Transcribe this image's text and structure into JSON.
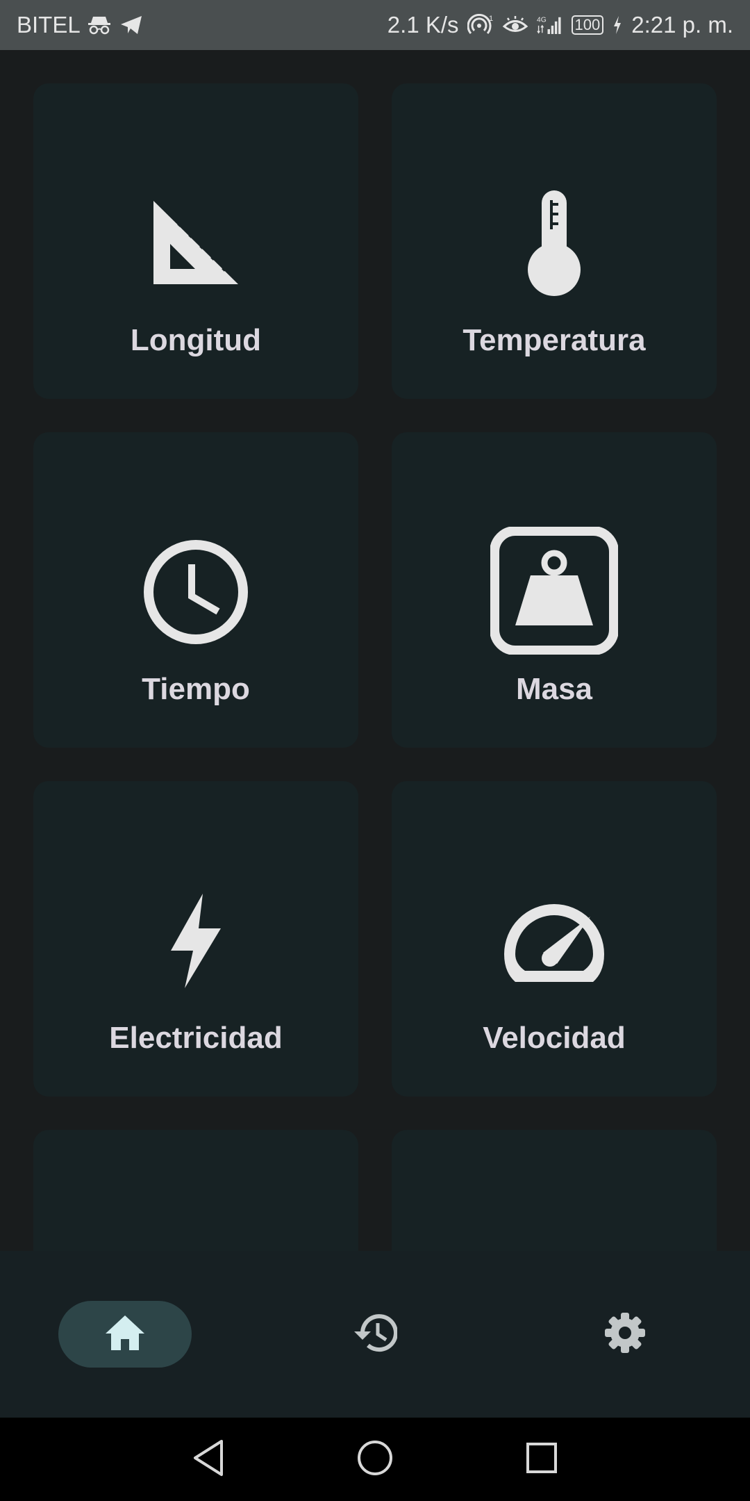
{
  "status_bar": {
    "carrier": "BITEL",
    "net_speed": "2.1 K/s",
    "signal_type": "4G",
    "battery": "100",
    "time": "2:21 p. m."
  },
  "categories": [
    {
      "label": "Longitud",
      "icon": "set-square-icon"
    },
    {
      "label": "Temperatura",
      "icon": "thermometer-icon"
    },
    {
      "label": "Tiempo",
      "icon": "clock-icon"
    },
    {
      "label": "Masa",
      "icon": "weight-icon"
    },
    {
      "label": "Electricidad",
      "icon": "lightning-icon"
    },
    {
      "label": "Velocidad",
      "icon": "speedometer-icon"
    }
  ],
  "bottom_nav": {
    "items": [
      {
        "icon": "home-icon",
        "selected": true
      },
      {
        "icon": "history-icon",
        "selected": false
      },
      {
        "icon": "settings-icon",
        "selected": false
      }
    ]
  },
  "colors": {
    "background": "#191c1d",
    "card": "#172224",
    "label": "#dcd8e0",
    "nav_selected": "#2d4548",
    "nav_icon_selected": "#d4eef0"
  }
}
